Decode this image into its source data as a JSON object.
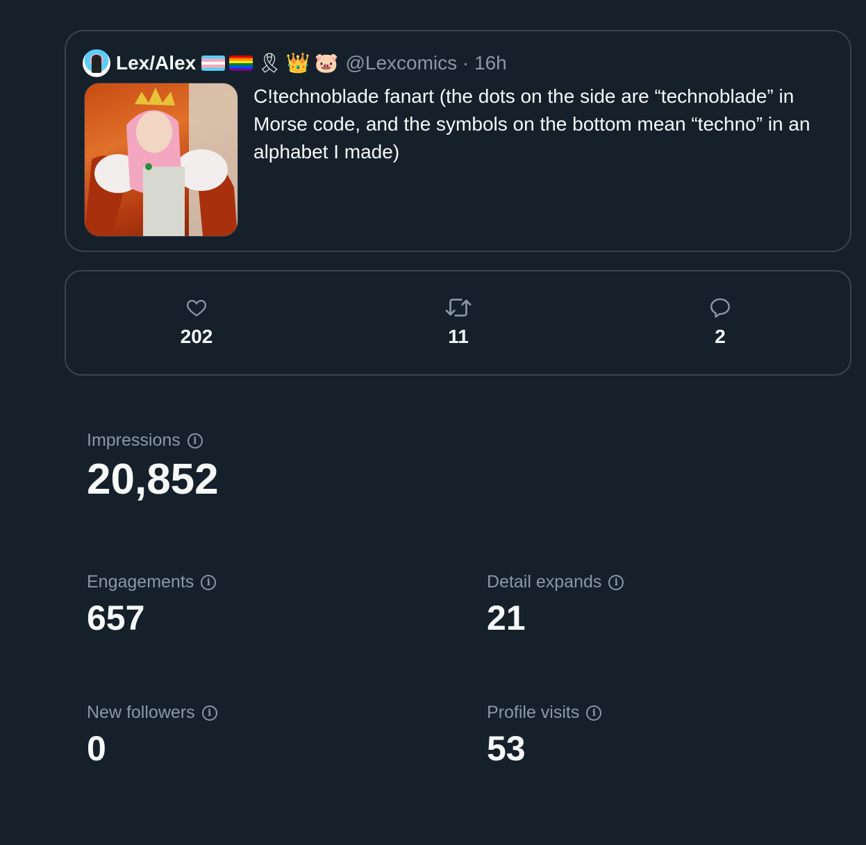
{
  "tweet": {
    "display_name": "Lex/Alex",
    "flags": [
      "transgender-flag",
      "rainbow-flag"
    ],
    "emojis": [
      "🎗",
      "👑",
      "🐷"
    ],
    "handle": "@Lexcomics · 16h",
    "text": "C!technoblade fanart (the dots on the side are “technoblade” in Morse code, and the symbols on the bottom mean “techno” in an alphabet I made)"
  },
  "engagement_bar": {
    "likes": "202",
    "retweets": "11",
    "replies": "2"
  },
  "metrics": {
    "impressions": {
      "label": "Impressions",
      "value": "20,852"
    },
    "engagements": {
      "label": "Engagements",
      "value": "657"
    },
    "detail_expands": {
      "label": "Detail expands",
      "value": "21"
    },
    "new_followers": {
      "label": "New followers",
      "value": "0"
    },
    "profile_visits": {
      "label": "Profile visits",
      "value": "53"
    }
  },
  "colors": {
    "background": "#15202b",
    "border": "#38444d",
    "muted_text": "#8b98a5",
    "primary_text": "#f7f9f9"
  }
}
